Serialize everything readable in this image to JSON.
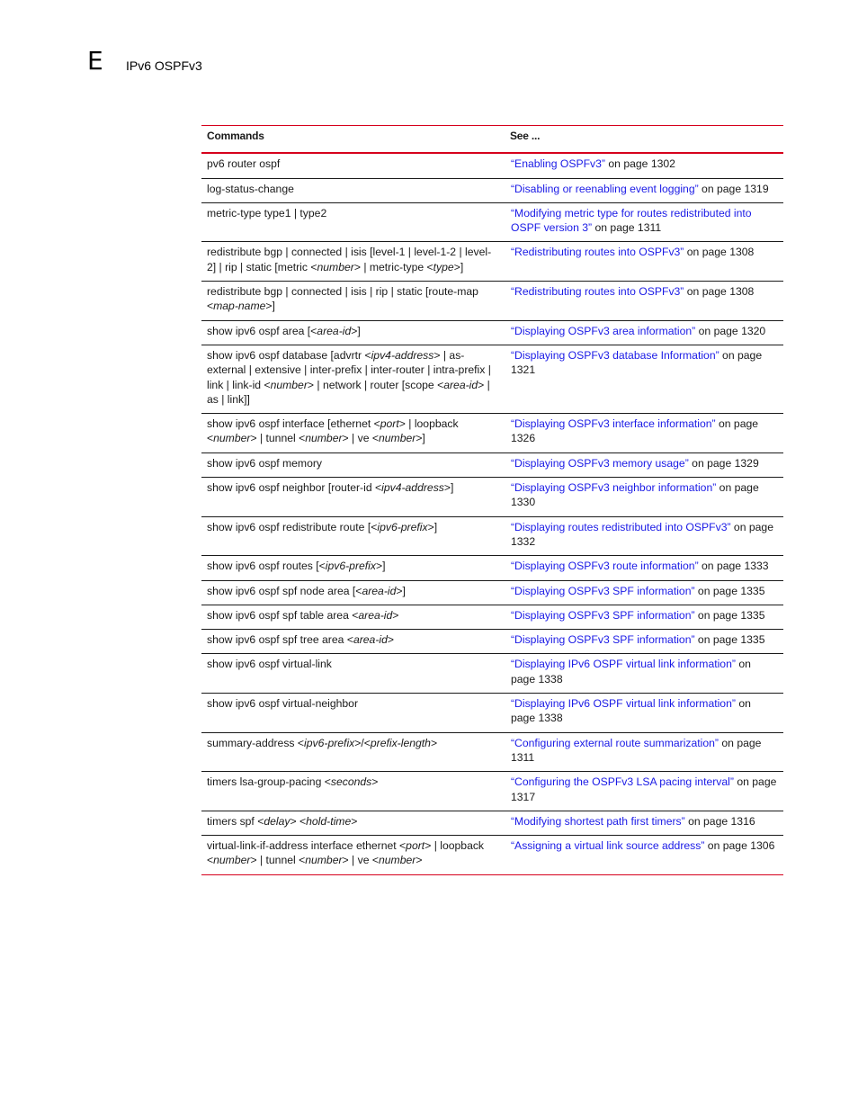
{
  "header": {
    "chapter_letter": "E",
    "chapter_title": "IPv6 OSPFv3"
  },
  "table": {
    "columns": [
      "Commands",
      "See ..."
    ],
    "rows": [
      {
        "command": [
          {
            "t": "pv6 router ospf"
          }
        ],
        "link": "“Enabling OSPFv3”",
        "suffix": " on page 1302"
      },
      {
        "command": [
          {
            "t": "log-status-change"
          }
        ],
        "link": "“Disabling or reenabling event logging”",
        "suffix": " on page 1319"
      },
      {
        "command": [
          {
            "t": "metric-type type1 | type2"
          }
        ],
        "link": "“Modifying metric type for routes redistributed into OSPF version 3”",
        "suffix": " on page 1311"
      },
      {
        "command": [
          {
            "t": "redistribute bgp | connected | isis [level-1 | level-1-2 | level-2] | rip | static [metric <"
          },
          {
            "t": "number",
            "i": true
          },
          {
            "t": "> | metric-type <"
          },
          {
            "t": "type",
            "i": true
          },
          {
            "t": ">]"
          }
        ],
        "link": "“Redistributing routes into OSPFv3”",
        "suffix": " on page 1308"
      },
      {
        "command": [
          {
            "t": "redistribute bgp | connected | isis | rip | static [route-map <"
          },
          {
            "t": "map-name",
            "i": true
          },
          {
            "t": ">]"
          }
        ],
        "link": "“Redistributing routes into OSPFv3”",
        "suffix": " on page 1308"
      },
      {
        "command": [
          {
            "t": "show ipv6 ospf area [<"
          },
          {
            "t": "area-id",
            "i": true
          },
          {
            "t": ">]"
          }
        ],
        "link": "“Displaying OSPFv3 area information”",
        "suffix": " on page 1320"
      },
      {
        "command": [
          {
            "t": "show ipv6 ospf database [advrtr <"
          },
          {
            "t": "ipv4-address",
            "i": true
          },
          {
            "t": "> | as-external | extensive | inter-prefix | inter-router | intra-prefix | link | link-id <"
          },
          {
            "t": "number",
            "i": true
          },
          {
            "t": "> | network | router [scope <"
          },
          {
            "t": "area-id",
            "i": true
          },
          {
            "t": "> | as | link]]"
          }
        ],
        "link": "“Displaying OSPFv3 database Information”",
        "suffix": " on page 1321"
      },
      {
        "command": [
          {
            "t": "show ipv6 ospf interface [ethernet <"
          },
          {
            "t": "port",
            "i": true
          },
          {
            "t": "> | loopback <"
          },
          {
            "t": "number",
            "i": true
          },
          {
            "t": "> | tunnel <"
          },
          {
            "t": "number",
            "i": true
          },
          {
            "t": "> | ve <"
          },
          {
            "t": "number",
            "i": true
          },
          {
            "t": ">]"
          }
        ],
        "link": "“Displaying OSPFv3 interface information”",
        "suffix": " on page 1326"
      },
      {
        "command": [
          {
            "t": "show ipv6 ospf memory"
          }
        ],
        "link": "“Displaying OSPFv3 memory usage”",
        "suffix": " on page 1329"
      },
      {
        "command": [
          {
            "t": "show ipv6 ospf neighbor [router-id <"
          },
          {
            "t": "ipv4-address",
            "i": true
          },
          {
            "t": ">]"
          }
        ],
        "link": "“Displaying OSPFv3 neighbor information”",
        "suffix": " on page 1330"
      },
      {
        "command": [
          {
            "t": "show ipv6 ospf redistribute route [<"
          },
          {
            "t": "ipv6-prefix",
            "i": true
          },
          {
            "t": ">]"
          }
        ],
        "link": "“Displaying routes redistributed into OSPFv3”",
        "suffix": " on page 1332"
      },
      {
        "command": [
          {
            "t": "show ipv6 ospf routes [<"
          },
          {
            "t": "ipv6-prefix",
            "i": true
          },
          {
            "t": ">]"
          }
        ],
        "link": "“Displaying OSPFv3 route information”",
        "suffix": " on page 1333"
      },
      {
        "command": [
          {
            "t": "show ipv6 ospf spf node area [<"
          },
          {
            "t": "area-id",
            "i": true
          },
          {
            "t": ">]"
          }
        ],
        "link": "“Displaying OSPFv3 SPF information”",
        "suffix": " on page 1335"
      },
      {
        "command": [
          {
            "t": "show ipv6 ospf spf table area <"
          },
          {
            "t": "area-id",
            "i": true
          },
          {
            "t": ">"
          }
        ],
        "link": "“Displaying OSPFv3 SPF information”",
        "suffix": " on page 1335"
      },
      {
        "command": [
          {
            "t": "show ipv6 ospf spf tree area <"
          },
          {
            "t": "area-id",
            "i": true
          },
          {
            "t": ">"
          }
        ],
        "link": "“Displaying OSPFv3 SPF information”",
        "suffix": " on page 1335"
      },
      {
        "command": [
          {
            "t": "show ipv6 ospf virtual-link"
          }
        ],
        "link": "“Displaying IPv6 OSPF virtual link information”",
        "suffix": " on page 1338"
      },
      {
        "command": [
          {
            "t": "show ipv6 ospf virtual-neighbor"
          }
        ],
        "link": "“Displaying IPv6 OSPF virtual link information”",
        "suffix": " on page 1338"
      },
      {
        "command": [
          {
            "t": "summary-address <"
          },
          {
            "t": "ipv6-prefix",
            "i": true
          },
          {
            "t": ">/<"
          },
          {
            "t": "prefix-length",
            "i": true
          },
          {
            "t": ">"
          }
        ],
        "link": "“Configuring external route summarization”",
        "suffix": " on page 1311"
      },
      {
        "command": [
          {
            "t": "timers lsa-group-pacing <"
          },
          {
            "t": "seconds",
            "i": true
          },
          {
            "t": ">"
          }
        ],
        "link": "“Configuring the OSPFv3 LSA pacing interval”",
        "suffix": " on page 1317"
      },
      {
        "command": [
          {
            "t": "timers spf <"
          },
          {
            "t": "delay",
            "i": true
          },
          {
            "t": "> <"
          },
          {
            "t": "hold-time",
            "i": true
          },
          {
            "t": ">"
          }
        ],
        "link": "“Modifying shortest path first timers”",
        "suffix": " on page 1316"
      },
      {
        "command": [
          {
            "t": "virtual-link-if-address interface ethernet <"
          },
          {
            "t": "port",
            "i": true
          },
          {
            "t": "> | loopback <"
          },
          {
            "t": "number",
            "i": true
          },
          {
            "t": "> | tunnel <"
          },
          {
            "t": "number",
            "i": true
          },
          {
            "t": "> | ve <"
          },
          {
            "t": "number",
            "i": true
          },
          {
            "t": ">"
          }
        ],
        "link": "“Assigning a virtual link source address”",
        "suffix": " on page 1306"
      }
    ]
  },
  "colors": {
    "rule_red": "#d6001c",
    "link_blue": "#1a1ae6"
  }
}
